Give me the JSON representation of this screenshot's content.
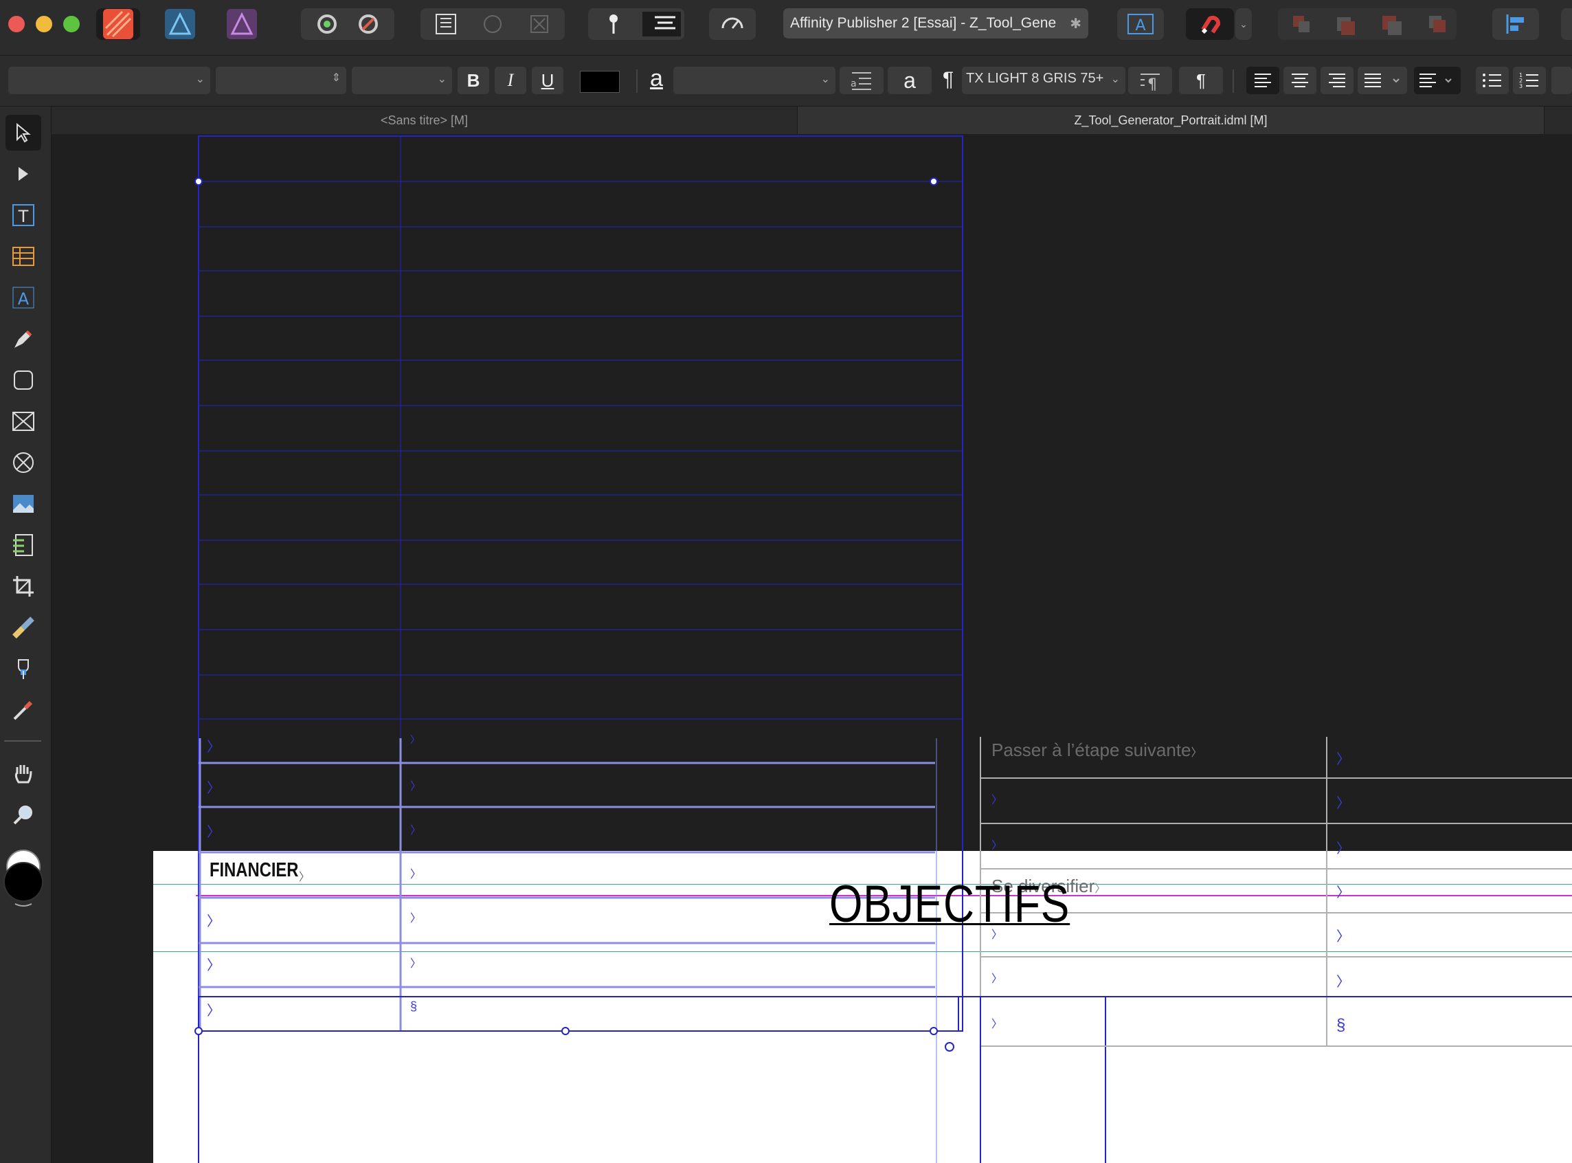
{
  "window": {
    "title": "Affinity Publisher 2 [Essai] - Z_Tool_Gene",
    "title_suffix": "✱"
  },
  "context_bar": {
    "font_family": "",
    "font_style": "",
    "font_size": "",
    "bold": "B",
    "italic": "I",
    "underline": "U",
    "char_style_glyph": "a",
    "char_style_value": "",
    "text_a_glyph": "a",
    "para_mark": "¶",
    "paragraph_style": "TX LIGHT 8 GRIS 75+",
    "pilcrow": "¶"
  },
  "tabs": [
    {
      "label": "<Sans titre> [M]"
    },
    {
      "label": "Z_Tool_Generator_Portrait.idml [M]"
    }
  ],
  "document": {
    "left_table": {
      "heading": "FINANCIER",
      "arrow_mark": "〉",
      "end_mark": "§"
    },
    "right_table": {
      "row1": "Passer à l’étape suivante",
      "row4": "Se diversifier",
      "arrow_mark": "〉",
      "end_mark": "§"
    },
    "big_title": "OBJECTIFS"
  },
  "colors": {
    "frame_blue": "#2323c8",
    "light_frame": "#8c8ce0",
    "accent_magenta": "#cc33cc",
    "teal_guide": "#3aa0a0"
  }
}
